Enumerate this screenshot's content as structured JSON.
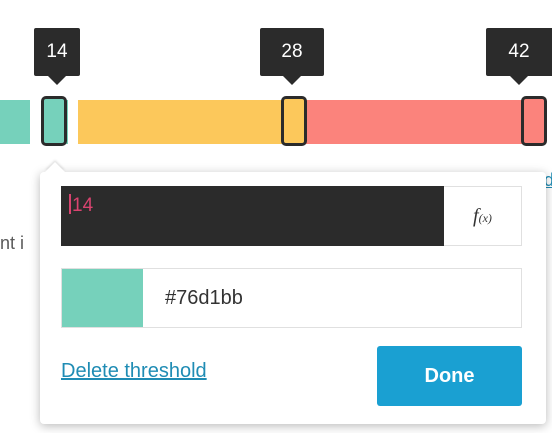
{
  "thresholds": [
    {
      "value": "14",
      "color": "#76d1bb"
    },
    {
      "value": "28",
      "color": "#fcc85b"
    },
    {
      "value": "42",
      "color": "#fb837c"
    }
  ],
  "background_text": {
    "left_fragment": "nt i",
    "right_fragment": "d"
  },
  "editor": {
    "value_field": "14",
    "function_button_label": "f",
    "function_button_sub": "(x)",
    "color_hex": "#76d1bb",
    "delete_label": "Delete threshold",
    "done_label": "Done"
  }
}
